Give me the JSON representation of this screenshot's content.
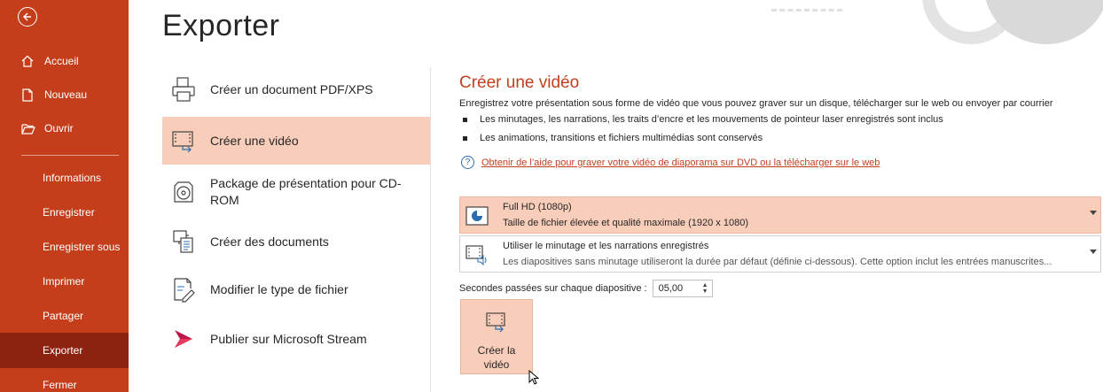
{
  "sidebar": {
    "top_items": [
      {
        "label": "Accueil",
        "icon": "home-icon"
      },
      {
        "label": "Nouveau",
        "icon": "new-document-icon"
      },
      {
        "label": "Ouvrir",
        "icon": "folder-open-icon"
      }
    ],
    "items": [
      {
        "label": "Informations"
      },
      {
        "label": "Enregistrer"
      },
      {
        "label": "Enregistrer sous"
      },
      {
        "label": "Imprimer"
      },
      {
        "label": "Partager"
      },
      {
        "label": "Exporter",
        "active": true
      },
      {
        "label": "Fermer"
      }
    ]
  },
  "page_title": "Exporter",
  "options": [
    {
      "label": "Créer un document PDF/XPS",
      "icon": "pdf-document-icon"
    },
    {
      "label": "Créer une vidéo",
      "icon": "video-icon",
      "active": true
    },
    {
      "label": "Package de présentation pour CD-ROM",
      "icon": "cd-rom-icon"
    },
    {
      "label": "Créer des documents",
      "icon": "handouts-icon"
    },
    {
      "label": "Modifier le type de fichier",
      "icon": "change-file-type-icon"
    },
    {
      "label": "Publier sur Microsoft Stream",
      "icon": "stream-icon"
    }
  ],
  "panel": {
    "title": "Créer une vidéo",
    "description": "Enregistrez votre présentation sous forme de vidéo que vous pouvez graver sur un disque, télécharger sur le web ou envoyer par courrier",
    "bullets": [
      "Les minutages, les narrations, les traits d’encre et les mouvements de pointeur laser enregistrés sont inclus",
      "Les animations, transitions et fichiers multimédias sont conservés"
    ],
    "help_link": "Obtenir de l’aide pour graver votre vidéo de diaporama sur DVD ou la télécharger sur le web",
    "quality": {
      "title": "Full HD (1080p)",
      "subtitle": "Taille de fichier élevée et qualité maximale (1920 x 1080)"
    },
    "timing": {
      "title": "Utiliser le minutage et les narrations enregistrés",
      "subtitle": "Les diapositives sans minutage utiliseront la durée par défaut (définie ci-dessous). Cette option inclut les entrées manuscrites..."
    },
    "seconds_label": "Secondes passées sur chaque diapositive :",
    "seconds_value": "05,00",
    "create_button": "Créer la vidéo"
  },
  "colors": {
    "accent": "#c43e1c",
    "selected": "#f8cdb9",
    "sidebar_active": "#8c2311"
  }
}
